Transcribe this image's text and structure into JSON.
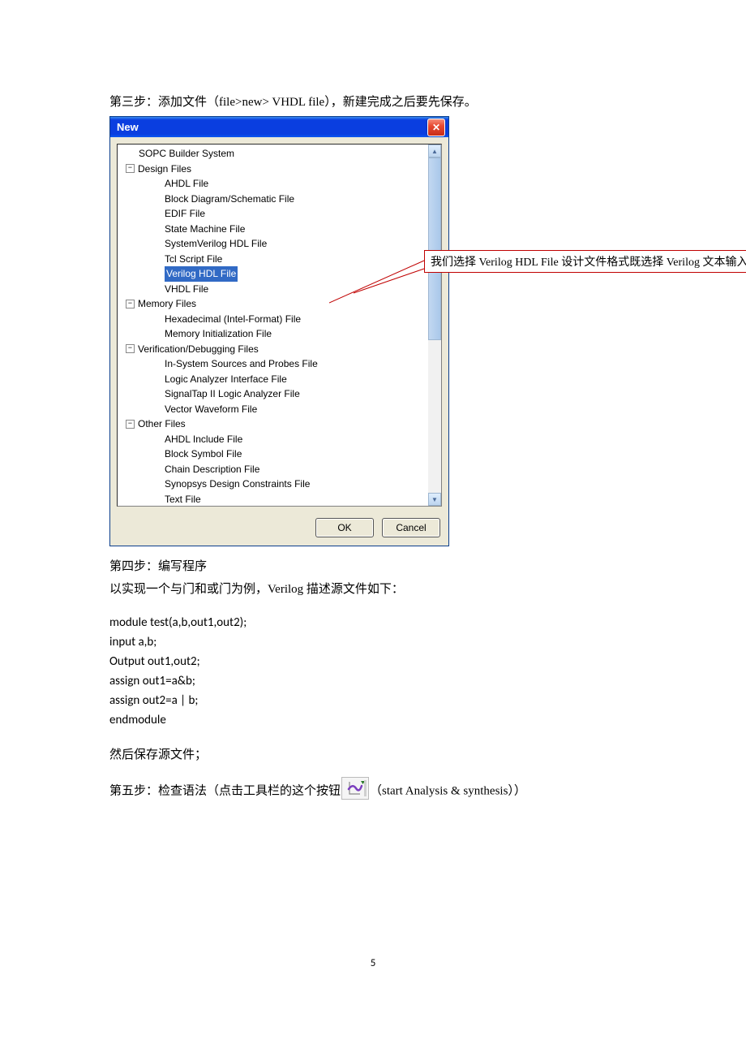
{
  "step3_text": "第三步：添加文件（file>new> VHDL file），新建完成之后要先保存。",
  "dialog": {
    "title": "New",
    "ok": "OK",
    "cancel": "Cancel",
    "tree": {
      "sopc": "SOPC Builder System",
      "design": "Design Files",
      "ahdl": "AHDL File",
      "block": "Block Diagram/Schematic File",
      "edif": "EDIF File",
      "statemachine": "State Machine File",
      "sysverilog": "SystemVerilog HDL File",
      "tcl": "Tcl Script File",
      "verilog": "Verilog HDL File",
      "vhdl": "VHDL File",
      "memory": "Memory Files",
      "hex": "Hexadecimal (Intel-Format) File",
      "mif": "Memory Initialization File",
      "verify": "Verification/Debugging Files",
      "insys": "In-System Sources and Probes File",
      "lai": "Logic Analyzer Interface File",
      "stp": "SignalTap II Logic Analyzer File",
      "vwf": "Vector Waveform File",
      "other": "Other Files",
      "ahdlinc": "AHDL Include File",
      "bsf": "Block Symbol File",
      "cdf": "Chain Description File",
      "sdc": "Synopsys Design Constraints File",
      "txt": "Text File"
    }
  },
  "callout": "我们选择 Verilog HDL File 设计文件格式既选择 Verilog 文本输入形式",
  "step4_a": "第四步：编写程序",
  "step4_b": "以实现一个与门和或门为例，Verilog 描述源文件如下：",
  "code": {
    "l1": "module test(a,b,out1,out2);",
    "l2": "input a,b;",
    "l3": "Output out1,out2;",
    "l4": "assign out1=a&b;",
    "l5": "assign out2=a | b;",
    "l6": "endmodule"
  },
  "save_note": "然后保存源文件；",
  "step5_a": "第五步：检查语法（点击工具栏的这个按钮",
  "step5_b": "（start Analysis & synthesis））",
  "page_number": "5"
}
